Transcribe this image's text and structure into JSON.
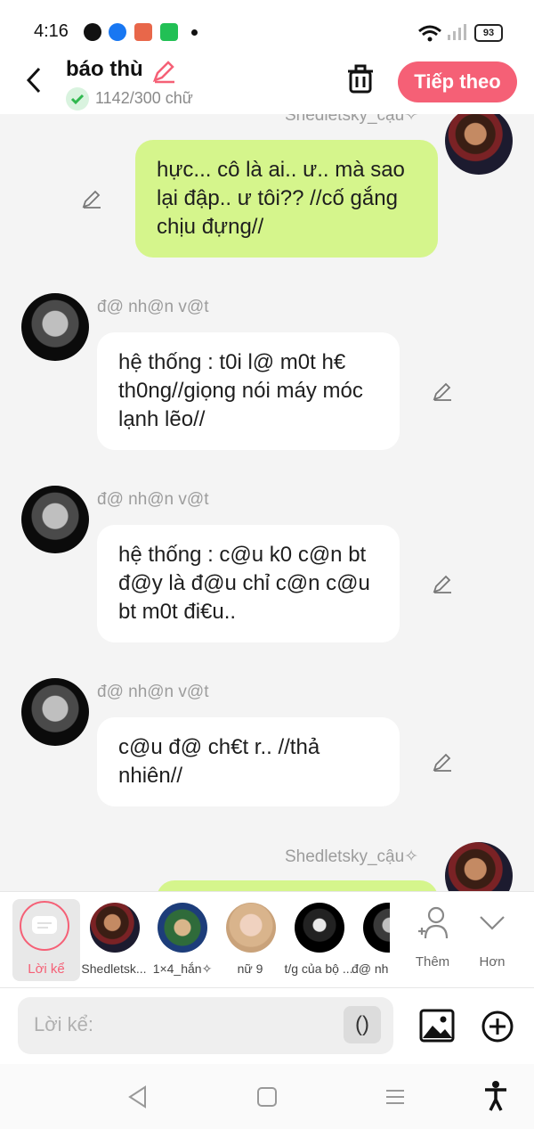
{
  "status_bar": {
    "time": "4:16",
    "battery": "93"
  },
  "header": {
    "title": "báo thù",
    "word_count": "1142/300 chữ",
    "next_label": "Tiếp theo"
  },
  "messages": [
    {
      "sender": "Shedletsky_cậu✧",
      "text": "hực... cô là ai.. ư.. mà sao lại đập.. ư tôi?? //cố gắng chịu đựng//",
      "side": "right"
    },
    {
      "sender": "đ@ nh@n v@t",
      "text": "hệ thống : t0i l@ m0t h€ th0ng//giọng nói máy móc lạnh lẽo//",
      "side": "left"
    },
    {
      "sender": "đ@ nh@n v@t",
      "text": "hệ thống : c@u k0 c@n bt đ@y là đ@u chỉ c@n c@u bt m0t đi€u..",
      "side": "left"
    },
    {
      "sender": "đ@ nh@n v@t",
      "text": "c@u đ@ ch€t r.. //thả nhiên//",
      "side": "left"
    },
    {
      "sender": "Shedletsky_cậu✧",
      "text": "",
      "side": "right"
    }
  ],
  "characters": {
    "narrator_label": "Lời kể",
    "items": [
      "Shedletsk...",
      "1×4_hắn✧",
      "nữ 9",
      "t/g của bộ ...",
      "đ@ nh..."
    ],
    "more_label": "Thêm",
    "expand_label": "Hơn"
  },
  "composer": {
    "placeholder": "Lời kể:",
    "paren_label": "()"
  },
  "colors": {
    "accent": "#f56076",
    "user_bubble": "#d5f58c",
    "npc_bubble": "#ffffff"
  }
}
